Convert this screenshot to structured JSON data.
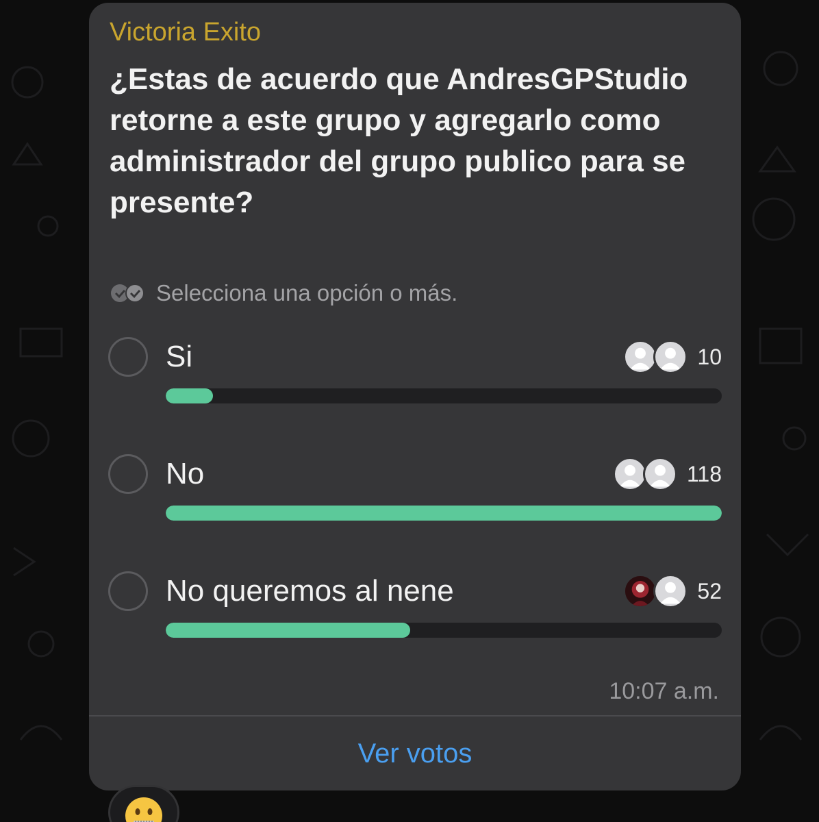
{
  "message": {
    "sender": "Victoria Exito",
    "question": "¿Estas de acuerdo que AndresGPStudio retorne a este grupo y agregarlo como administrador del grupo publico para se presente?",
    "hint": "Selecciona una opción o más.",
    "options": [
      {
        "label": "Si",
        "votes": "10",
        "fraction": 0.085
      },
      {
        "label": "No",
        "votes": "118",
        "fraction": 1.0
      },
      {
        "label": "No queremos al nene",
        "votes": "52",
        "fraction": 0.44
      }
    ],
    "time": "10:07 a.m.",
    "view_votes_label": "Ver votos"
  },
  "icons": {
    "hint": "double-check-icon",
    "voter": "person-avatar-icon",
    "reaction": "zipper-mouth-face-icon"
  },
  "colors": {
    "sender": "#c9a52e",
    "bar_fill": "#5cc99a",
    "link": "#4a9ff0",
    "bubble": "#363638"
  }
}
